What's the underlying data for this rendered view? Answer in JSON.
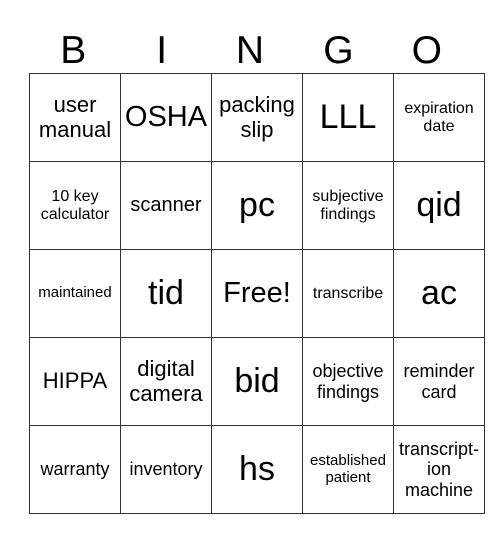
{
  "title_letters": [
    "B",
    "I",
    "N",
    "G",
    "O"
  ],
  "rows": [
    [
      "user manual",
      "OSHA",
      "packing slip",
      "LLL",
      "expiration date"
    ],
    [
      "10 key calculator",
      "scanner",
      "pc",
      "subjective findings",
      "qid"
    ],
    [
      "maintained",
      "tid",
      "Free!",
      "transcribe",
      "ac"
    ],
    [
      "HIPPA",
      "digital camera",
      "bid",
      "objective findings",
      "reminder card"
    ],
    [
      "warranty",
      "inventory",
      "hs",
      "established patient",
      "transcript-ion machine"
    ]
  ]
}
